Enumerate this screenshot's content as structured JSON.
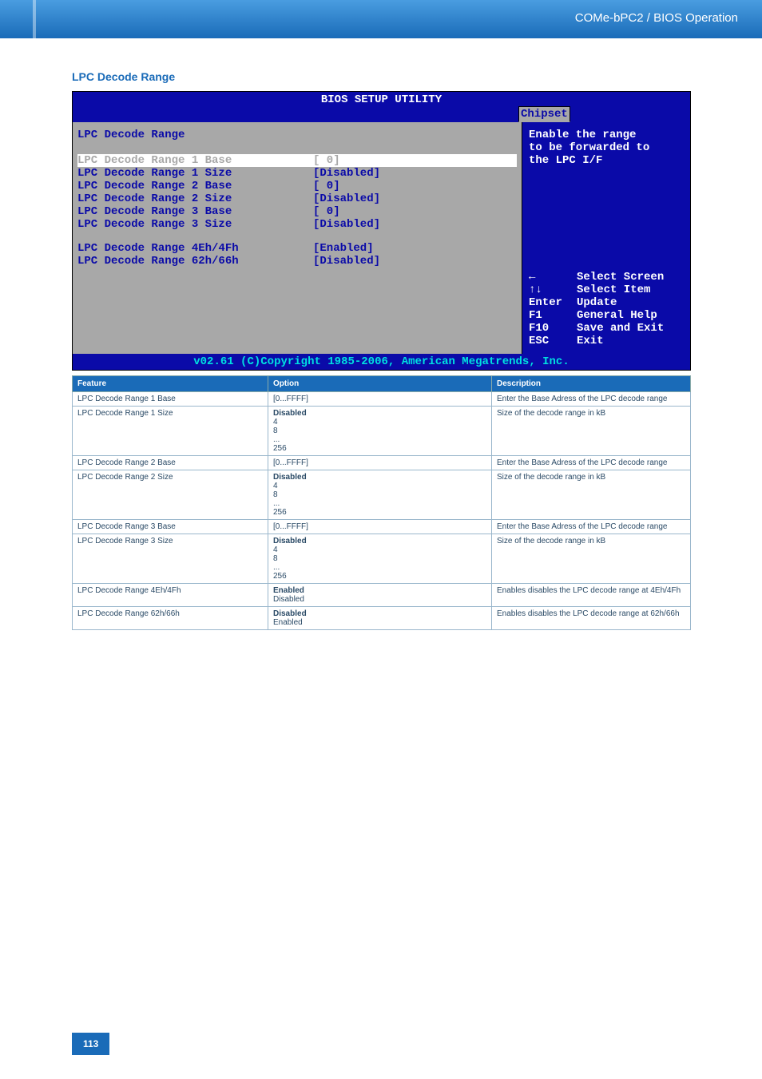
{
  "header": {
    "title": "COMe-bPC2 / BIOS Operation"
  },
  "section_title": "LPC Decode Range",
  "bios": {
    "title": "BIOS SETUP UTILITY",
    "tab": "Chipset",
    "panel_title": "LPC Decode Range",
    "items": [
      {
        "label": "LPC Decode Range 1 Base",
        "value": "[   0]",
        "selected": true
      },
      {
        "label": "LPC Decode Range 1 Size",
        "value": "[Disabled]"
      },
      {
        "label": "LPC Decode Range 2 Base",
        "value": "[   0]"
      },
      {
        "label": "LPC Decode Range 2 Size",
        "value": "[Disabled]"
      },
      {
        "label": "LPC Decode Range 3 Base",
        "value": "[   0]"
      },
      {
        "label": "LPC Decode Range 3 Size",
        "value": "[Disabled]"
      }
    ],
    "items2": [
      {
        "label": "LPC Decode Range 4Eh/4Fh",
        "value": "[Enabled]"
      },
      {
        "label": "LPC Decode Range 62h/66h",
        "value": "[Disabled]"
      }
    ],
    "hint_l1": "Enable the range",
    "hint_l2": "to be forwarded to",
    "hint_l3": "the LPC I/F",
    "help": {
      "k0": "←",
      "l0": "Select Screen",
      "k1": "↑↓",
      "l1": "Select Item",
      "k2": "Enter",
      "l2": "Update",
      "k3": "F1",
      "l3": "General Help",
      "k4": "F10",
      "l4": "Save and Exit",
      "k5": "ESC",
      "l5": "Exit"
    },
    "footer": "v02.61 (C)Copyright 1985-2006, American Megatrends, Inc."
  },
  "table": {
    "headers": {
      "feature": "Feature",
      "option": "Option",
      "description": "Description"
    },
    "rows": [
      {
        "feature": "LPC Decode Range 1 Base",
        "option": "[0...FFFF]",
        "description": "Enter the Base Adress of the LPC decode range"
      },
      {
        "feature": "LPC Decode Range 1 Size",
        "option_bold": "Disabled",
        "option_rest": "4\n8\n...\n256",
        "description": "Size of the decode range in kB"
      },
      {
        "feature": "LPC Decode Range 2 Base",
        "option": "[0...FFFF]",
        "description": "Enter the Base Adress of the LPC decode range"
      },
      {
        "feature": "LPC Decode Range 2 Size",
        "option_bold": "Disabled",
        "option_rest": "4\n8\n...\n256",
        "description": "Size of the decode range in kB"
      },
      {
        "feature": "LPC Decode Range 3 Base",
        "option": "[0...FFFF]",
        "description": "Enter the Base Adress of the LPC decode range"
      },
      {
        "feature": "LPC Decode Range 3 Size",
        "option_bold": "Disabled",
        "option_rest": "4\n8\n...\n256",
        "description": "Size of the decode range in kB"
      },
      {
        "feature": "LPC Decode Range 4Eh/4Fh",
        "option_bold": "Enabled",
        "option_rest": "Disabled",
        "description": "Enables disables the LPC decode range at 4Eh/4Fh"
      },
      {
        "feature": "LPC Decode Range 62h/66h",
        "option_bold": "Disabled",
        "option_rest": "Enabled",
        "description": "Enables disables the LPC decode range at 62h/66h"
      }
    ]
  },
  "page_number": "113"
}
